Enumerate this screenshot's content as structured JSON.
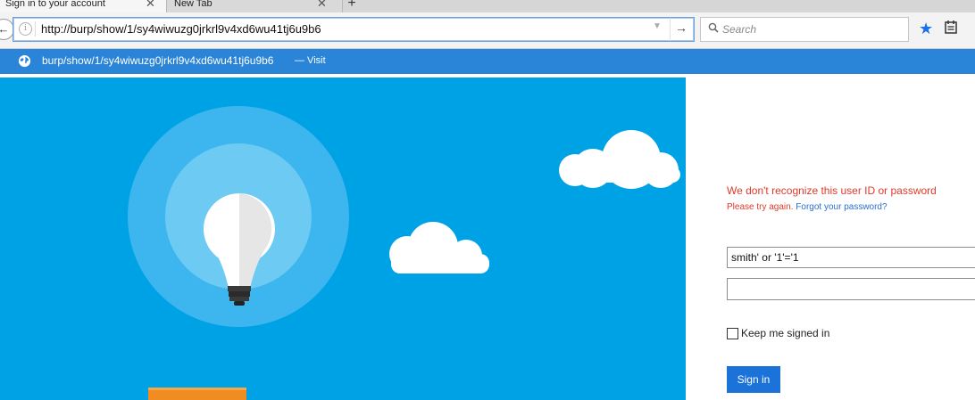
{
  "tabs": [
    {
      "label": "Sign in to your account"
    },
    {
      "label": "New Tab"
    }
  ],
  "new_tab_label": "+",
  "close_glyph": "✕",
  "navbar": {
    "back_glyph": "←",
    "url": "http://burp/show/1/sy4wiwuzg0jrkrl9v4xd6wu41tj6u9b6",
    "go_glyph": "→",
    "search_placeholder": "Search",
    "star_color": "#1a72e8"
  },
  "suggestion": {
    "url": "burp/show/1/sy4wiwuzg0jrkrl9v4xd6wu41tj6u9b6",
    "visit": "— Visit",
    "bar_color": "#2a84d7"
  },
  "hero": {
    "background_color": "#00a2e6"
  },
  "signin": {
    "error_title": "We don't recognize this user ID or password",
    "error_prefix": "Please try again.",
    "forgot_link": "Forgot your password?",
    "userid_value": "smith' or '1'='1",
    "password_value": "",
    "keep_signed_in": "Keep me signed in",
    "keep_signed_in_checked": false,
    "signin_button": "Sign in",
    "error_color": "#e03a2a",
    "button_color": "#1b73d9"
  }
}
